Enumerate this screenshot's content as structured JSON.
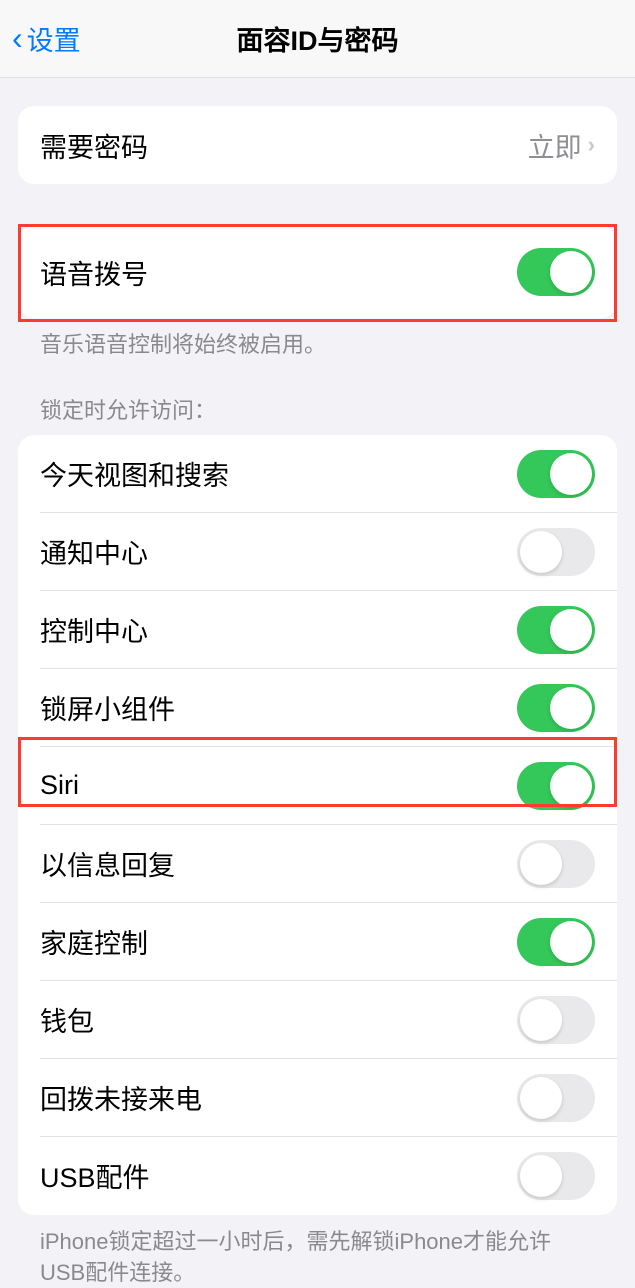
{
  "nav": {
    "back_label": "设置",
    "title": "面容ID与密码"
  },
  "section1": {
    "require_passcode_label": "需要密码",
    "require_passcode_value": "立即"
  },
  "section2": {
    "voice_dial_label": "语音拨号",
    "voice_dial_footer": "音乐语音控制将始终被启用。"
  },
  "section3": {
    "header": "锁定时允许访问：",
    "items": [
      {
        "label": "今天视图和搜索",
        "on": true
      },
      {
        "label": "通知中心",
        "on": false
      },
      {
        "label": "控制中心",
        "on": true
      },
      {
        "label": "锁屏小组件",
        "on": true
      },
      {
        "label": "Siri",
        "on": true
      },
      {
        "label": "以信息回复",
        "on": false
      },
      {
        "label": "家庭控制",
        "on": true
      },
      {
        "label": "钱包",
        "on": false
      },
      {
        "label": "回拨未接来电",
        "on": false
      },
      {
        "label": "USB配件",
        "on": false
      }
    ],
    "footer": "iPhone锁定超过一小时后，需先解锁iPhone才能允许USB配件连接。"
  }
}
